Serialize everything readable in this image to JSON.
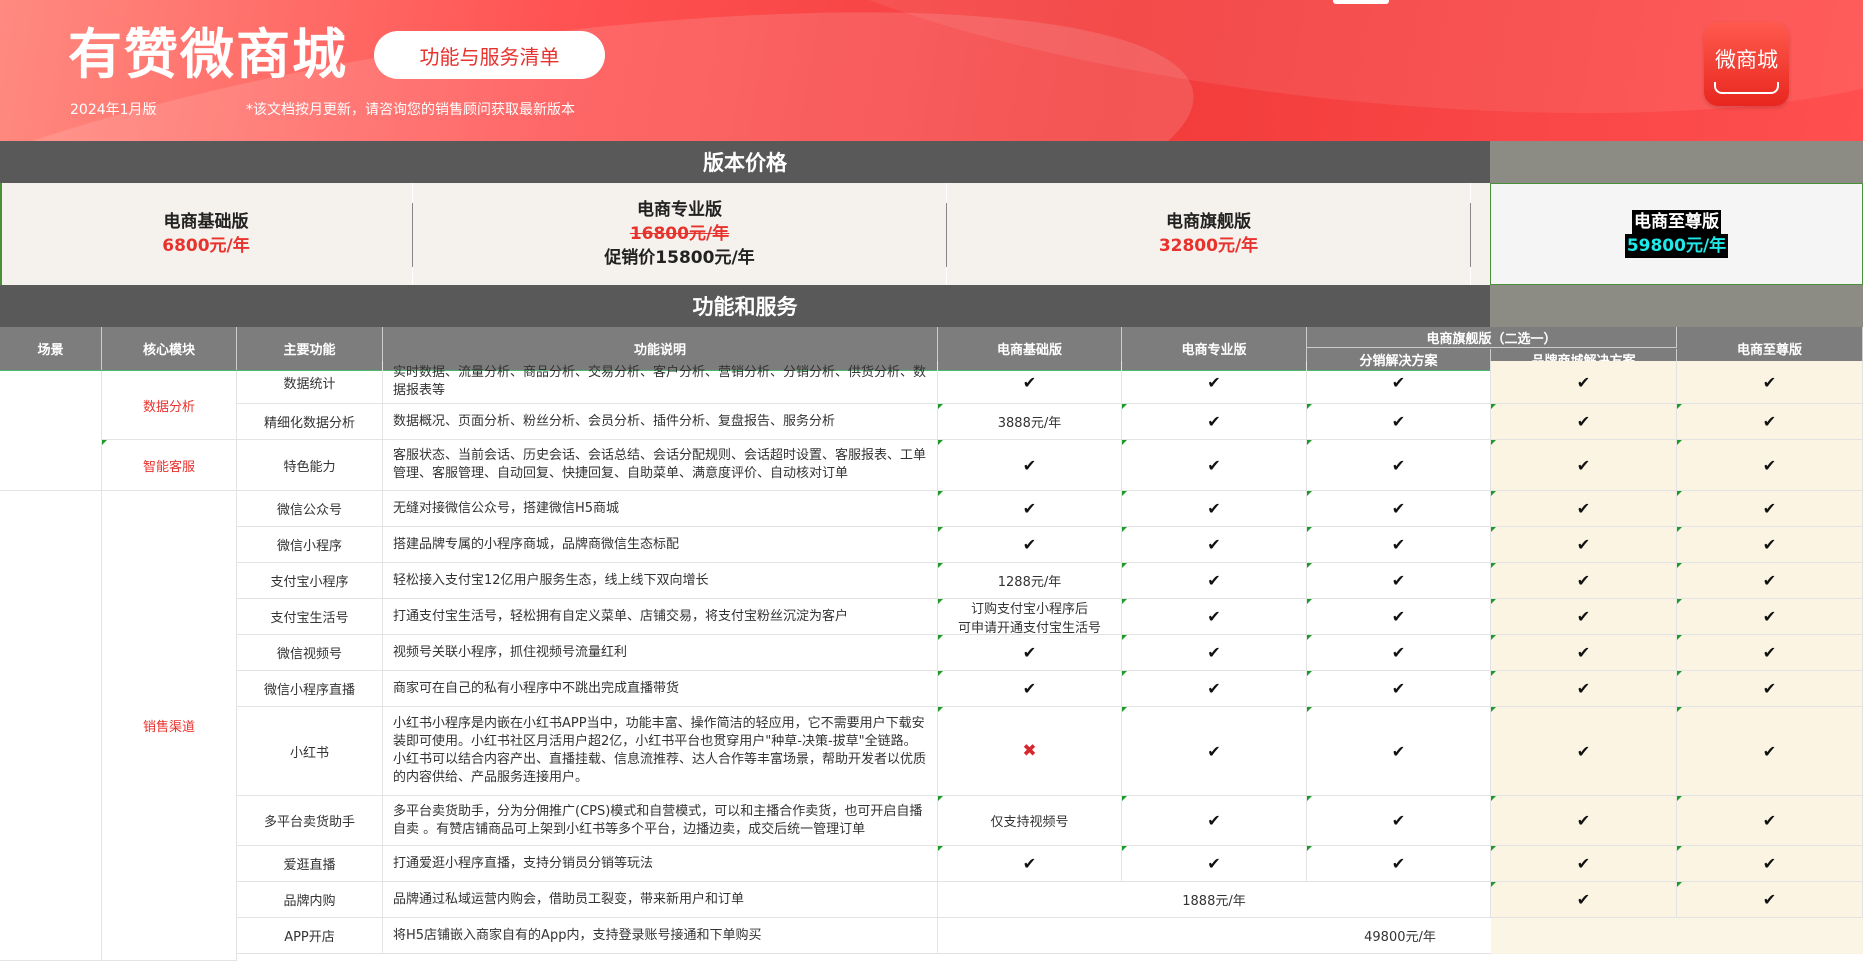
{
  "header": {
    "title": "有赞微商城",
    "service_button": "功能与服务清单",
    "version_date": "2024年1月版",
    "note": "*该文档按月更新，请咨询您的销售顾问获取最新版本",
    "logo_text": "微商城"
  },
  "sections": {
    "pricing": "版本价格",
    "features": "功能和服务"
  },
  "plans": {
    "basic": {
      "name": "电商基础版",
      "price": "6800元/年"
    },
    "pro": {
      "name": "电商专业版",
      "original_price": "16800元/年",
      "promo": "促销价15800元/年"
    },
    "flagship": {
      "name": "电商旗舰版",
      "price": "32800元/年"
    },
    "supreme": {
      "name": "电商至尊版",
      "price": "59800元/年"
    }
  },
  "table_header": {
    "scene": "场景",
    "module": "核心模块",
    "feature": "主要功能",
    "desc": "功能说明",
    "basic": "电商基础版",
    "pro": "电商专业版",
    "flagship_group": "电商旗舰版（二选一）",
    "flagship_a": "分销解决方案",
    "flagship_b": "品牌商城解决方案",
    "supreme": "电商至尊版"
  },
  "modules": {
    "data_analysis": "数据分析",
    "smart_service": "智能客服",
    "sales_channel": "销售渠道"
  },
  "rows": [
    {
      "feature": "数据统计",
      "desc": "实时数据、流量分析、商品分析、交易分析、客户分析、营销分析、分销分析、供货分析、数据报表等",
      "basic": "✔",
      "pro": "✔",
      "fa": "✔",
      "fb": "✔",
      "sup": "✔"
    },
    {
      "feature": "精细化数据分析",
      "desc": "数据概况、页面分析、粉丝分析、会员分析、插件分析、复盘报告、服务分析",
      "basic": "3888元/年",
      "pro": "✔",
      "fa": "✔",
      "fb": "✔",
      "sup": "✔"
    },
    {
      "feature": "特色能力",
      "desc": "客服状态、当前会话、历史会话、会话总结、会话分配规则、会话超时设置、客服报表、工单管理、客服管理、自动回复、快捷回复、自助菜单、满意度评价、自动核对订单",
      "basic": "✔",
      "pro": "✔",
      "fa": "✔",
      "fb": "✔",
      "sup": "✔"
    },
    {
      "feature": "微信公众号",
      "desc": "无缝对接微信公众号，搭建微信H5商城",
      "basic": "✔",
      "pro": "✔",
      "fa": "✔",
      "fb": "✔",
      "sup": "✔"
    },
    {
      "feature": "微信小程序",
      "desc": "搭建品牌专属的小程序商城，品牌商微信生态标配",
      "basic": "✔",
      "pro": "✔",
      "fa": "✔",
      "fb": "✔",
      "sup": "✔"
    },
    {
      "feature": "支付宝小程序",
      "desc": "轻松接入支付宝12亿用户服务生态，线上线下双向增长",
      "basic": "1288元/年",
      "pro": "✔",
      "fa": "✔",
      "fb": "✔",
      "sup": "✔"
    },
    {
      "feature": "支付宝生活号",
      "desc": "打通支付宝生活号，轻松拥有自定义菜单、店铺交易，将支付宝粉丝沉淀为客户",
      "basic": "订购支付宝小程序后\n可申请开通支付宝生活号",
      "pro": "✔",
      "fa": "✔",
      "fb": "✔",
      "sup": "✔"
    },
    {
      "feature": "微信视频号",
      "desc": "视频号关联小程序，抓住视频号流量红利",
      "basic": "✔",
      "pro": "✔",
      "fa": "✔",
      "fb": "✔",
      "sup": "✔"
    },
    {
      "feature": "微信小程序直播",
      "desc": "商家可在自己的私有小程序中不跳出完成直播带货",
      "basic": "✔",
      "pro": "✔",
      "fa": "✔",
      "fb": "✔",
      "sup": "✔"
    },
    {
      "feature": "小红书",
      "desc": "小红书小程序是内嵌在小红书APP当中，功能丰富、操作简洁的轻应用，它不需要用户下载安装即可使用。小红书社区月活用户超2亿，小红书平台也贯穿用户\"种草-决策-拔草\"全链路。小红书可以结合内容产出、直播挂载、信息流推荐、达人合作等丰富场景，帮助开发者以优质的内容供给、产品服务连接用户。",
      "basic": "✖",
      "pro": "✔",
      "fa": "✔",
      "fb": "✔",
      "sup": "✔"
    },
    {
      "feature": "多平台卖货助手",
      "desc": "多平台卖货助手，分为分佣推广(CPS)模式和自营模式，可以和主播合作卖货，也可开启自播自卖 。有赞店铺商品可上架到小红书等多个平台，边播边卖，成交后统一管理订单",
      "basic": "仅支持视频号",
      "pro": "✔",
      "fa": "✔",
      "fb": "✔",
      "sup": "✔"
    },
    {
      "feature": "爱逛直播",
      "desc": "打通爱逛小程序直播，支持分销员分销等玩法",
      "basic": "✔",
      "pro": "✔",
      "fa": "✔",
      "fb": "✔",
      "sup": "✔"
    },
    {
      "feature": "品牌内购",
      "desc": "品牌通过私域运营内购会，借助员工裂变，带来新用户和订单",
      "merged": "1888元/年",
      "fb": "✔",
      "sup": "✔"
    },
    {
      "feature": "APP开店",
      "desc": "将H5店铺嵌入商家自有的App内，支持登录账号接通和下单购买",
      "merged": "49800元/年"
    }
  ]
}
